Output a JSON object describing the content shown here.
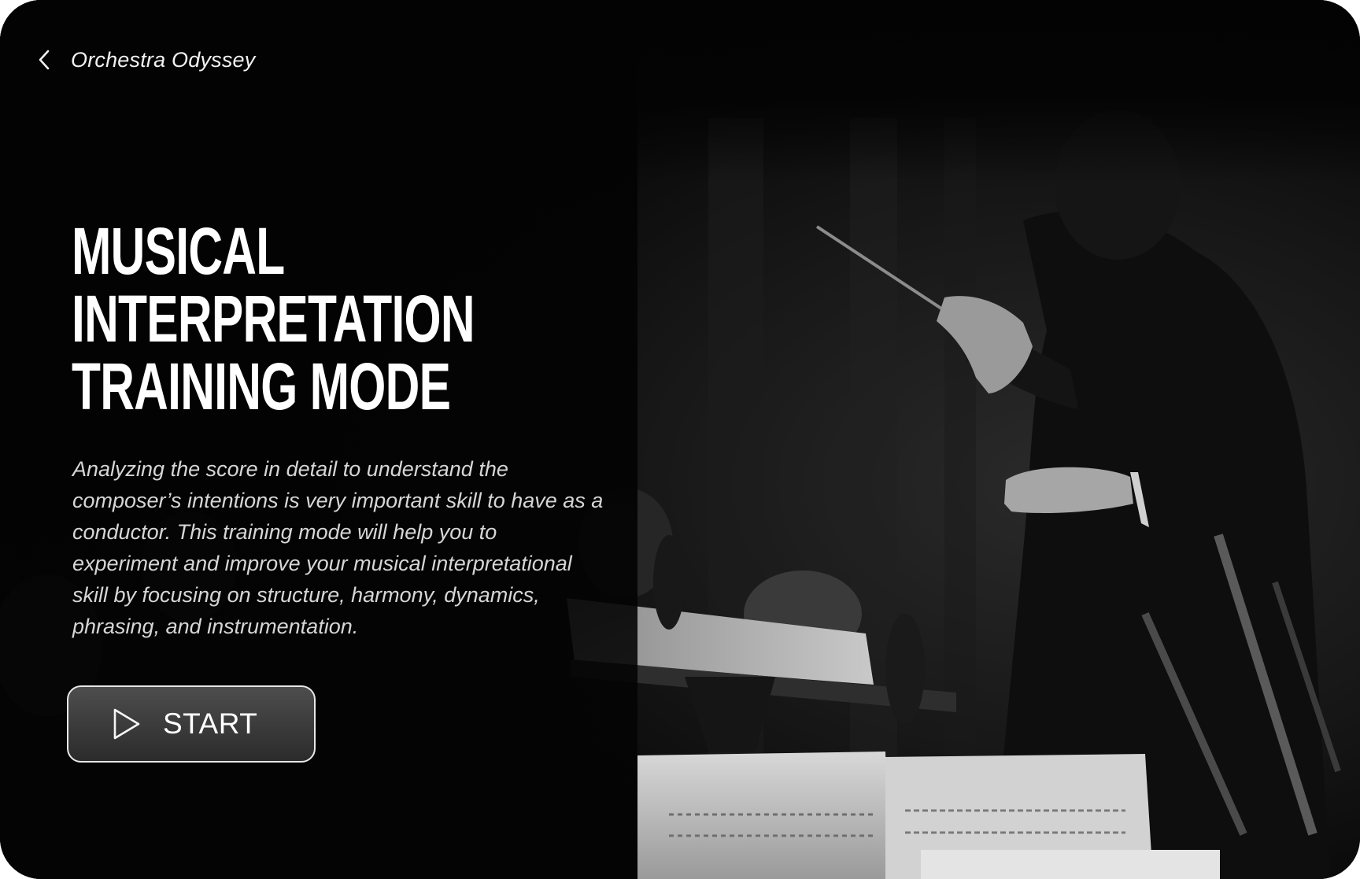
{
  "header": {
    "back_icon": "chevron-left-icon",
    "app_title": "Orchestra Odyssey"
  },
  "hero": {
    "title_lines": [
      "MUSICAL",
      "INTERPRETATION",
      "TRAINING MODE"
    ],
    "description": "Analyzing the score in detail to understand the composer’s intentions is very important skill to have as a conductor. This training mode will help you to experiment and improve your musical interpretational skill by focusing on structure, harmony, dynamics, phrasing, and instrumentation."
  },
  "start_button": {
    "icon": "play-icon",
    "label": "START"
  },
  "colors": {
    "background": "#030303",
    "text_primary": "#ffffff",
    "text_secondary": "#d6d6d6",
    "button_border": "#e8e8e8"
  }
}
